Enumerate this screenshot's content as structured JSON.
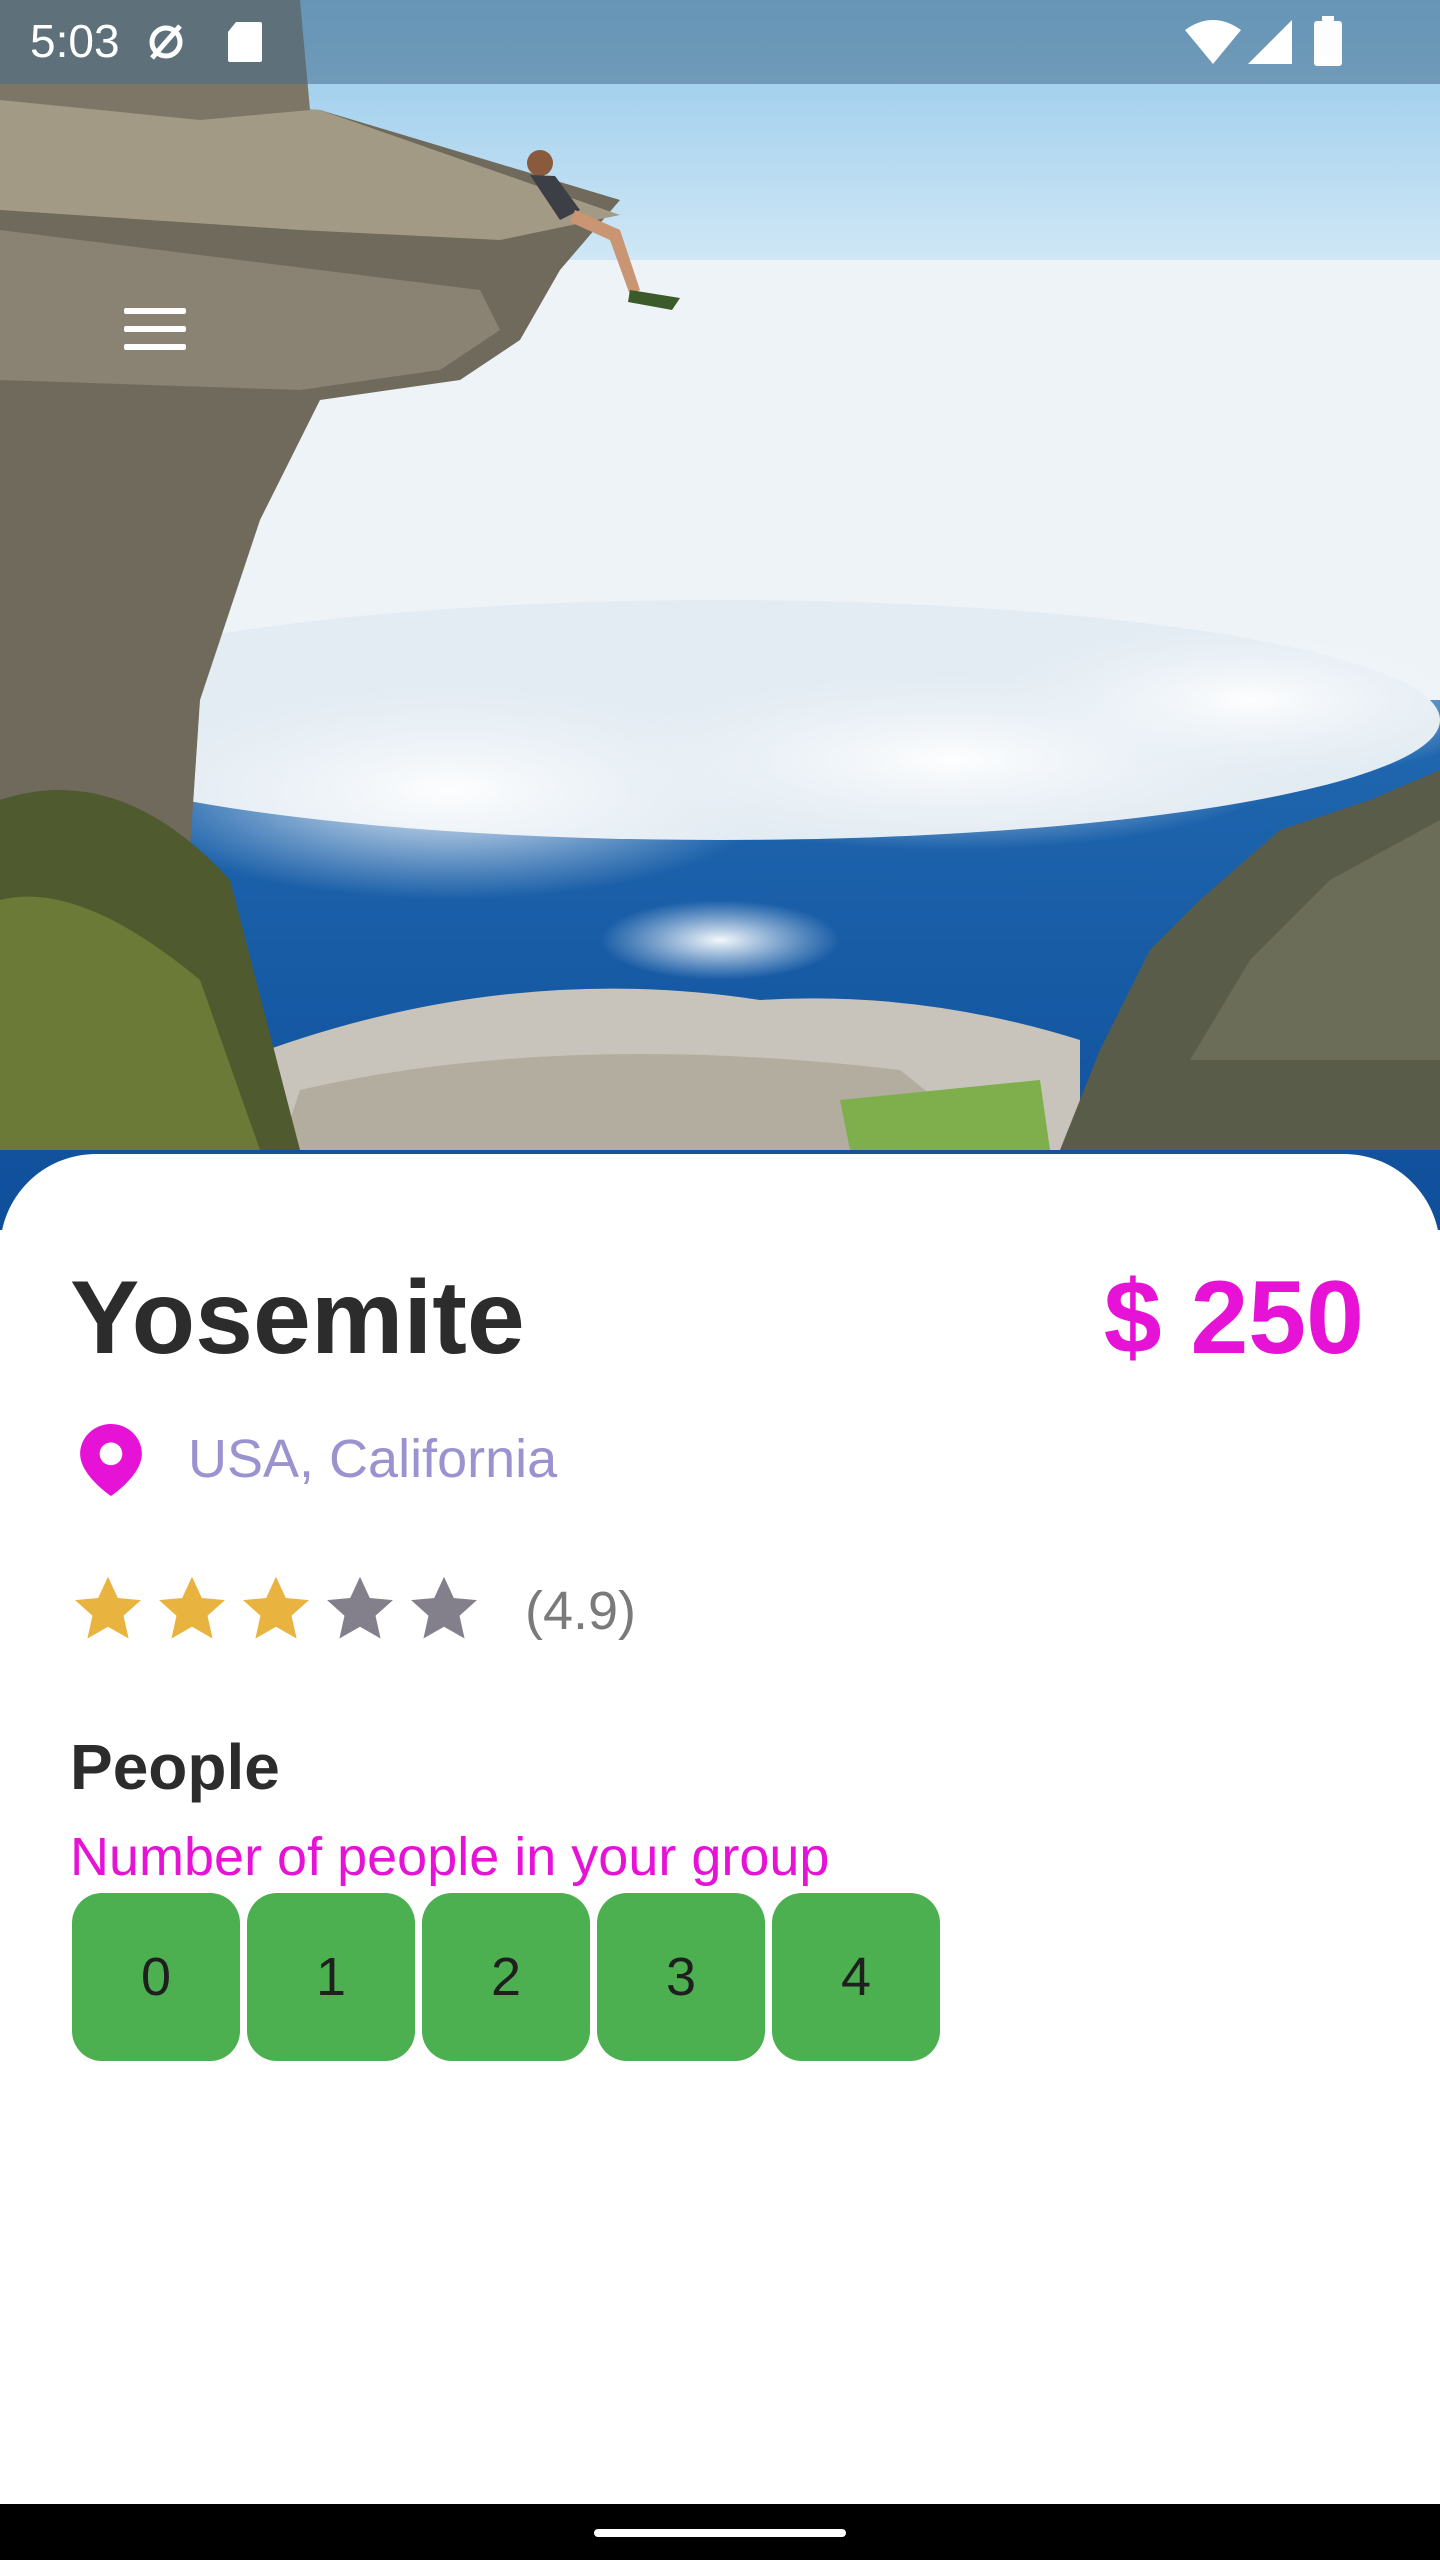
{
  "status_bar": {
    "time": "5:03",
    "icons": [
      "sync-off-icon",
      "sd-card-icon",
      "wifi-icon",
      "signal-icon",
      "battery-icon"
    ]
  },
  "hero": {
    "image": "cliff-over-clouds-photo",
    "menu_icon": "hamburger-menu-icon"
  },
  "place": {
    "name": "Yosemite",
    "price": "$ 250",
    "location": "USA, California",
    "rating_text": "(4.9)",
    "stars_filled": 3,
    "stars_total": 5
  },
  "people": {
    "heading": "People",
    "subtitle": "Number of people in your group",
    "options": [
      "0",
      "1",
      "2",
      "3",
      "4"
    ]
  },
  "colors": {
    "accent": "#e612d6",
    "location_text": "#9a93cf",
    "chip": "#4caf50",
    "star_filled": "#e8b33e",
    "star_empty": "#83808c",
    "title": "#2c2c2c"
  }
}
